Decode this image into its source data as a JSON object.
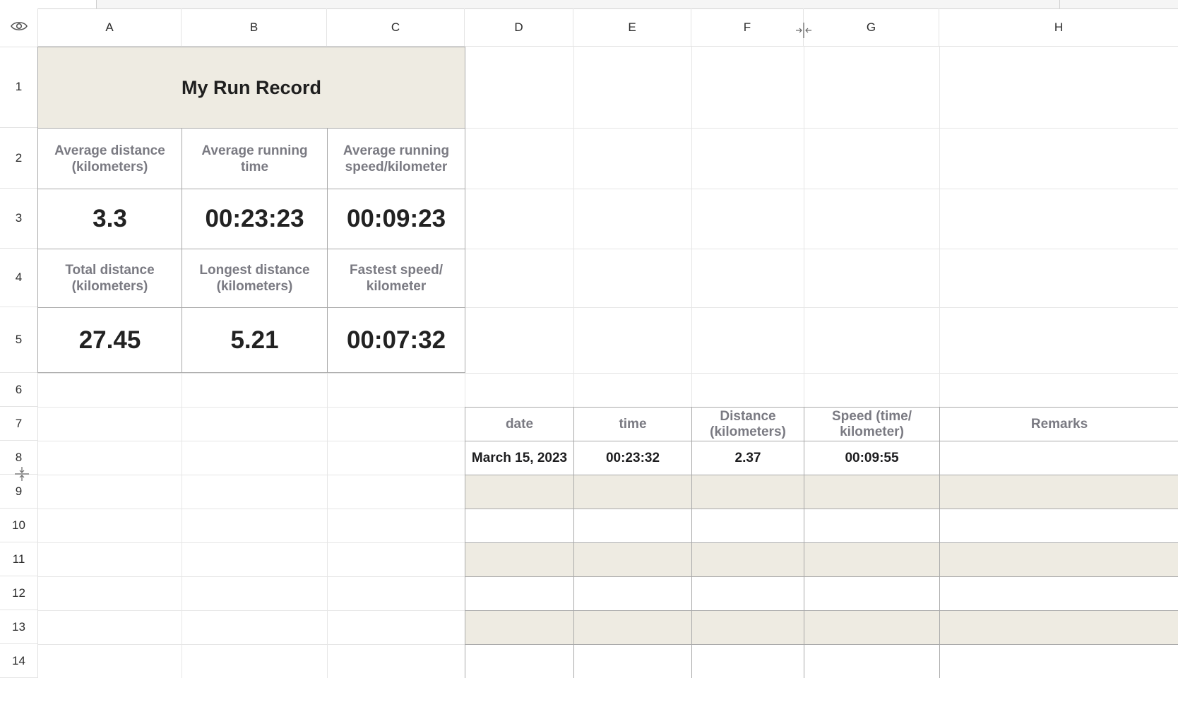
{
  "columns": [
    "A",
    "B",
    "C",
    "D",
    "E",
    "F",
    "G",
    "H"
  ],
  "rows": [
    "1",
    "2",
    "3",
    "4",
    "5",
    "6",
    "7",
    "8",
    "9",
    "10",
    "11",
    "12",
    "13",
    "14"
  ],
  "summary": {
    "title": "My Run Record",
    "avg_distance_label": "Average distance (kilometers)",
    "avg_time_label": "Average running time",
    "avg_speed_label": "Average running speed/kilometer",
    "avg_distance": "3.3",
    "avg_time": "00:23:23",
    "avg_speed": "00:09:23",
    "total_distance_label": "Total distance (kilometers)",
    "longest_distance_label": "Longest distance (kilometers)",
    "fastest_speed_label": "Fastest speed/ kilometer",
    "total_distance": "27.45",
    "longest_distance": "5.21",
    "fastest_speed": "00:07:32"
  },
  "log_table": {
    "headers": [
      "date",
      "time",
      "Distance (kilometers)",
      "Speed (time/ kilometer)",
      "Remarks"
    ],
    "rows": [
      {
        "date": "March 15, 2023",
        "time": "00:23:32",
        "distance": "2.37",
        "speed": "00:09:55",
        "remarks": ""
      }
    ]
  },
  "icons": {
    "corner": "eye-icon",
    "column_resize": "column-resize-icon",
    "row_resize": "row-resize-icon"
  },
  "colors": {
    "title_fill": "#eeebe2",
    "band_fill": "#eeebe2",
    "label_text": "#7a7a82",
    "border": "#a9a9a9"
  }
}
